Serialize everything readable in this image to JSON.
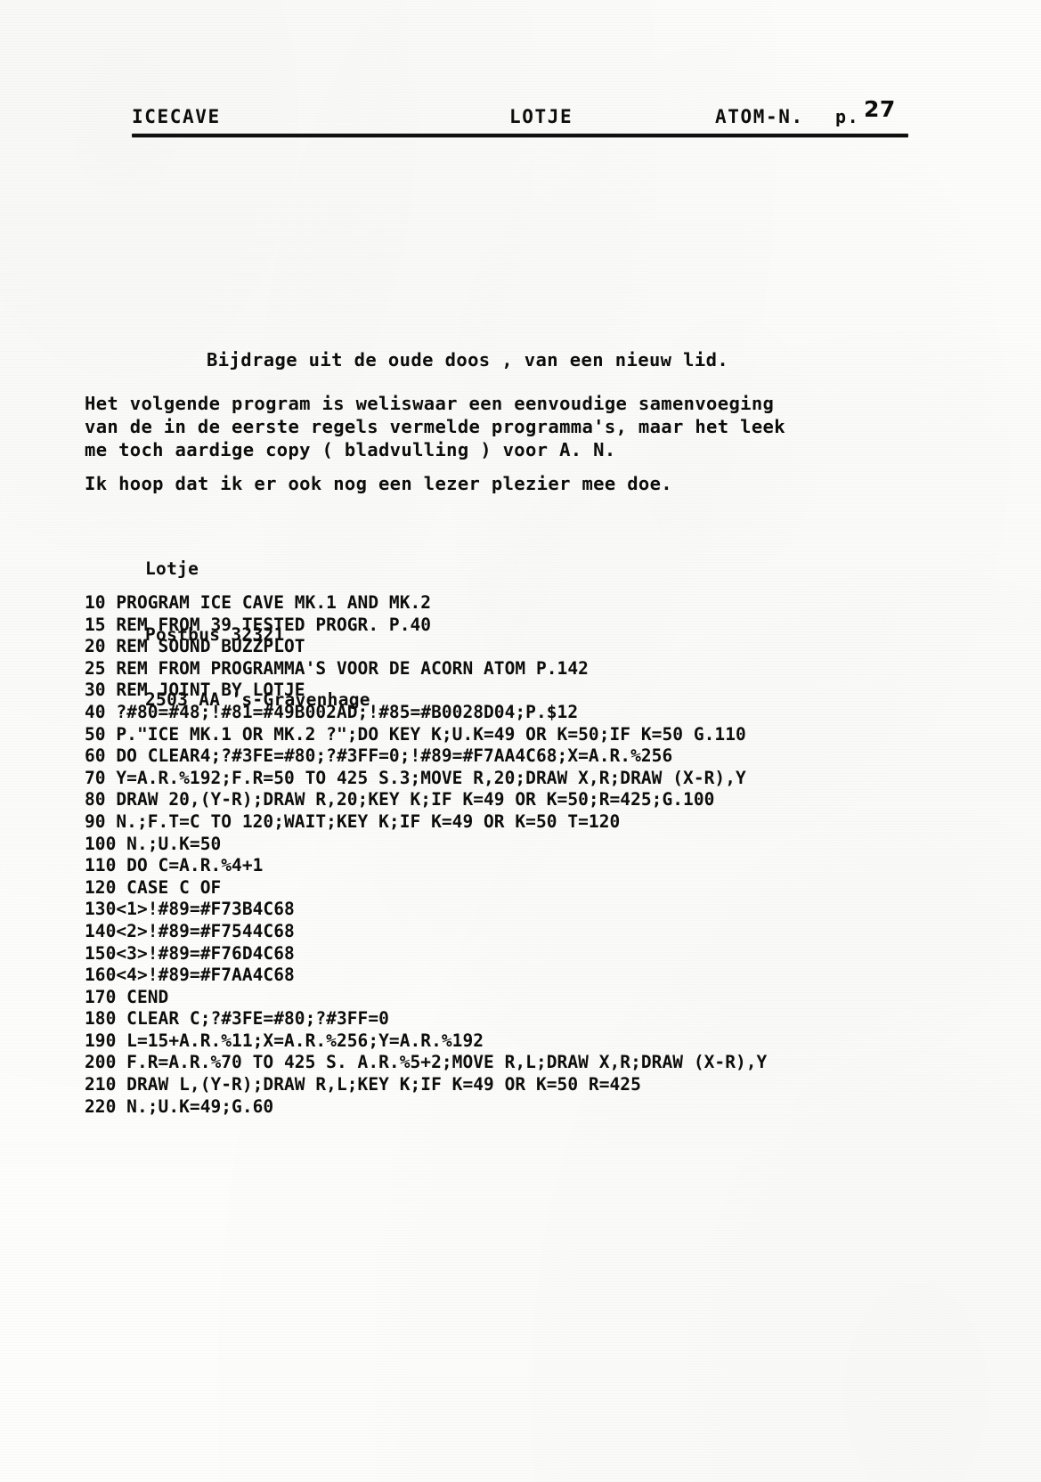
{
  "header": {
    "left": "ICECAVE",
    "center": "LOTJE",
    "right": "ATOM-N.",
    "page_label": "p.",
    "page_number": "27"
  },
  "intro": {
    "title": "Bijdrage uit de oude doos , van een nieuw lid.",
    "paragraph_1": "Het volgende program is weliswaar een eenvoudige samenvoeging\nvan de in de eerste regels vermelde programma's, maar het leek\nme toch aardige copy ( bladvulling ) voor A. N.",
    "paragraph_2": "Ik hoop dat ik er ook nog een lezer plezier mee doe."
  },
  "address": {
    "name": "Lotje",
    "po_box": "Postbus 32321",
    "city": "2503 AA 's-Gravenhage"
  },
  "program": {
    "lines": [
      "10 PROGRAM ICE CAVE MK.1 AND MK.2",
      "15 REM FROM 39 TESTED PROGR. P.40",
      "20 REM SOUND BUZZPLOT",
      "25 REM FROM PROGRAMMA'S VOOR DE ACORN ATOM P.142",
      "30 REM JOINT BY LOTJE",
      "40 ?#80=#48;!#81=#49B002AD;!#85=#B0028D04;P.$12",
      "50 P.\"ICE MK.1 OR MK.2 ?\";DO KEY K;U.K=49 OR K=50;IF K=50 G.110",
      "60 DO CLEAR4;?#3FE=#80;?#3FF=0;!#89=#F7AA4C68;X=A.R.%256",
      "70 Y=A.R.%192;F.R=50 TO 425 S.3;MOVE R,20;DRAW X,R;DRAW (X-R),Y",
      "80 DRAW 20,(Y-R);DRAW R,20;KEY K;IF K=49 OR K=50;R=425;G.100",
      "90 N.;F.T=C TO 120;WAIT;KEY K;IF K=49 OR K=50 T=120",
      "100 N.;U.K=50",
      "110 DO C=A.R.%4+1",
      "120 CASE C OF",
      "130<1>!#89=#F73B4C68",
      "140<2>!#89=#F7544C68",
      "150<3>!#89=#F76D4C68",
      "160<4>!#89=#F7AA4C68",
      "170 CEND",
      "180 CLEAR C;?#3FE=#80;?#3FF=0",
      "190 L=15+A.R.%11;X=A.R.%256;Y=A.R.%192",
      "200 F.R=A.R.%70 TO 425 S. A.R.%5+2;MOVE R,L;DRAW X,R;DRAW (X-R),Y",
      "210 DRAW L,(Y-R);DRAW R,L;KEY K;IF K=49 OR K=50 R=425",
      "220 N.;U.K=49;G.60"
    ]
  }
}
